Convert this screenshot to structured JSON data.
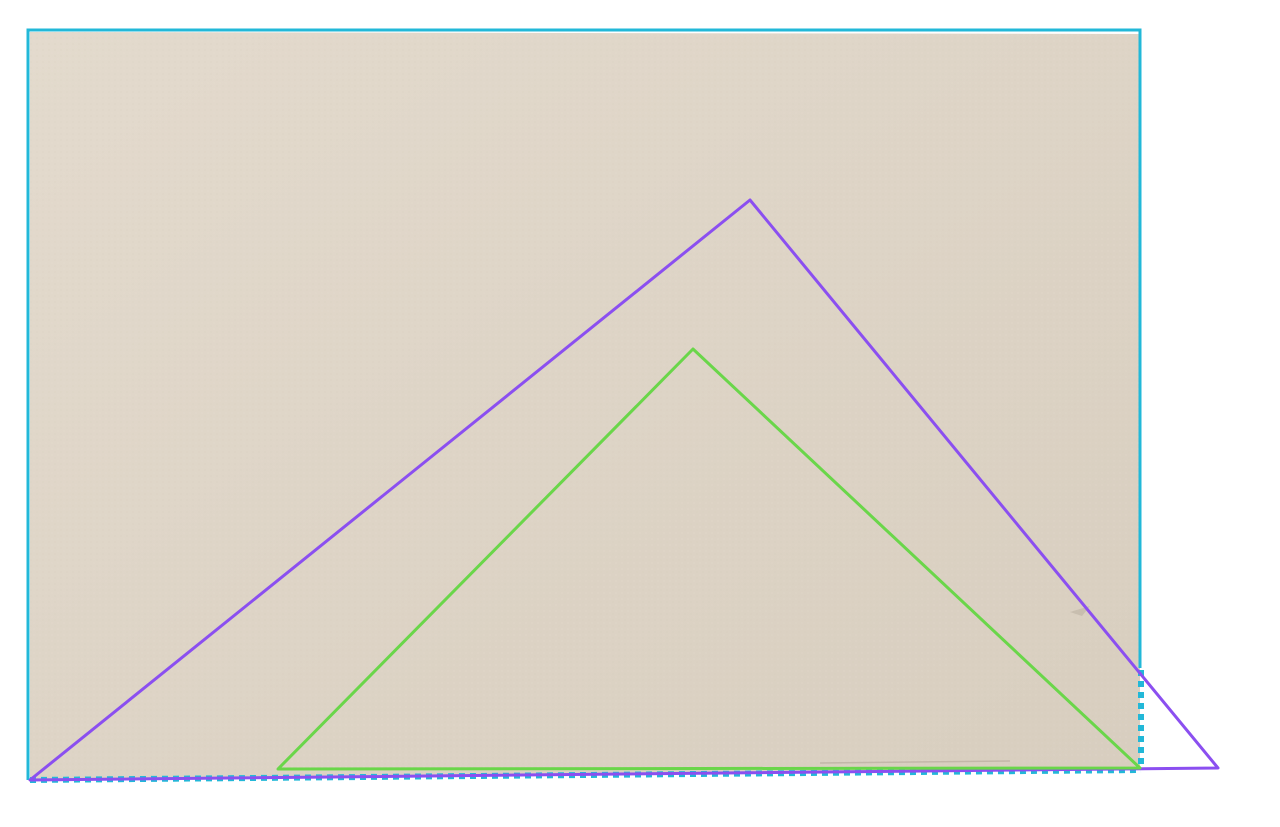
{
  "canvas": {
    "background": "#ffffff",
    "paper_color": "#e3dacd",
    "paper_color_dark": "#d8cebf"
  },
  "shapes": {
    "frame": {
      "color": "#22b8d8",
      "style": "solid",
      "open_corner_style": "dotted"
    },
    "outer_triangle": {
      "color": "#8b4ff0",
      "style": "solid"
    },
    "inner_triangle": {
      "color": "#6ad64a",
      "style": "solid"
    }
  }
}
